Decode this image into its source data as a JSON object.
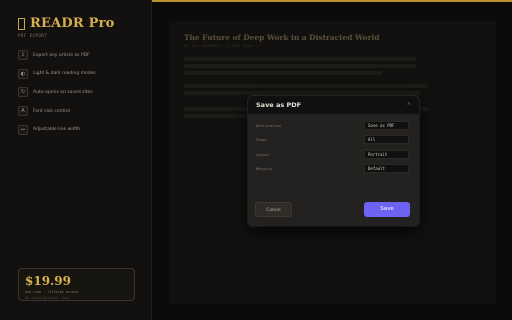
{
  "brand": {
    "title": "READR Pro",
    "subtitle": "PDF EXPORT",
    "icon": "book-icon"
  },
  "features": [
    {
      "icon": "⇩",
      "label": "Export any article as PDF"
    },
    {
      "icon": "◐",
      "label": "Light & dark reading modes"
    },
    {
      "icon": "↻",
      "label": "Auto-opens on saved sites"
    },
    {
      "icon": "A",
      "label": "Font size control"
    },
    {
      "icon": "↔",
      "label": "Adjustable line width"
    }
  ],
  "pricing": {
    "price": "$19.99",
    "line1": "One-time · lifetime access",
    "line2": "No subscriptions. Ever."
  },
  "article": {
    "title": "The Future of Deep Work in a Distracted World",
    "meta": "BY CAL NEWPORT · 8 MIN READ"
  },
  "modal": {
    "title": "Save as PDF",
    "close": "×",
    "rows": [
      {
        "label": "Destination",
        "value": "Save as PDF"
      },
      {
        "label": "Pages",
        "value": "All"
      },
      {
        "label": "Layout",
        "value": "Portrait"
      },
      {
        "label": "Margins",
        "value": "Default"
      }
    ],
    "cancel_label": "Cancel",
    "save_label": "Save"
  },
  "colors": {
    "accent": "#d6b04f",
    "primary_button": "#6c63f3",
    "background": "#0d0c0a"
  }
}
